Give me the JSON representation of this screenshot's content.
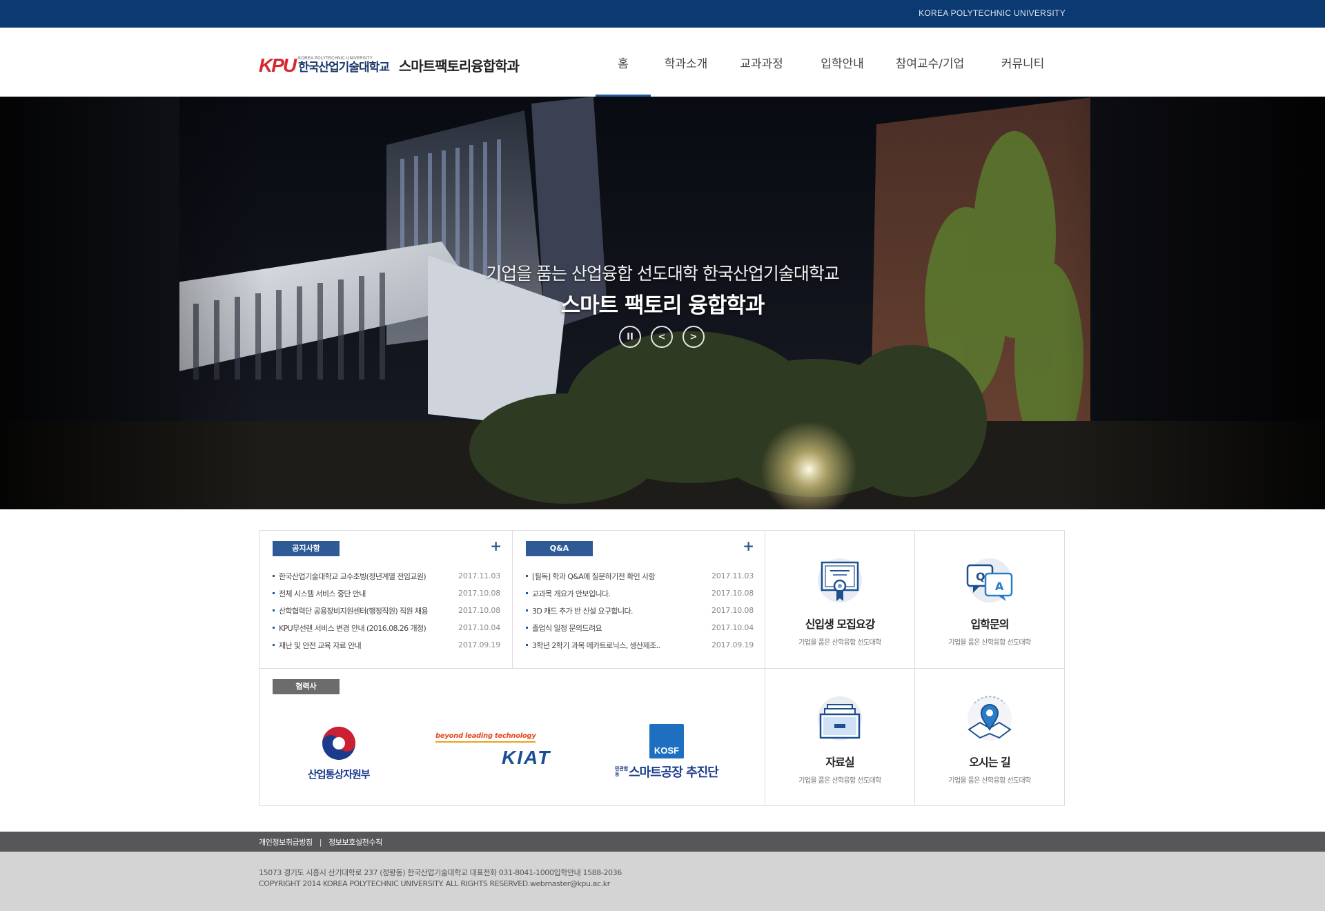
{
  "topbar": {
    "university": "KOREA POLYTECHNIC UNIVERSITY"
  },
  "header": {
    "logo_mark": "KPU",
    "logo_small": "KOREA POLYTECHNIC UNIVERSITY",
    "logo_name": "한국산업기술대학교",
    "dept": "스마트팩토리융합학과"
  },
  "nav": {
    "items": [
      {
        "label": "홈",
        "active": true
      },
      {
        "label": "학과소개"
      },
      {
        "label": "교과과정"
      },
      {
        "label": "입학안내"
      },
      {
        "label": "참여교수/기업"
      },
      {
        "label": "커뮤니티"
      }
    ]
  },
  "hero": {
    "caption1": "기업을 품는 산업융합 선도대학 한국산업기술대학교",
    "caption2": "스마트 팩토리 융합학과",
    "pause": "II",
    "prev": "<",
    "next": ">"
  },
  "notice": {
    "title": "공지사항",
    "more": "+",
    "items": [
      {
        "title": "한국산업기술대학교 교수초빙(정년계열 전임교원)",
        "date": "2017.11.03"
      },
      {
        "title": "전체 시스템 서비스 중단 안내",
        "date": "2017.10.08"
      },
      {
        "title": "산학협력단 공용장비지원센터(행정직원) 직원 채용",
        "date": "2017.10.08"
      },
      {
        "title": "KPU무선랜 서비스 변경 안내 (2016.08.26 개정)",
        "date": "2017.10.04"
      },
      {
        "title": "재난 및 안전 교육 자료 안내",
        "date": "2017.09.19"
      }
    ]
  },
  "qa": {
    "title": "Q&A",
    "more": "+",
    "items": [
      {
        "title": "[필독] 학과 Q&A에 질문하기전 확인 사항",
        "date": "2017.11.03"
      },
      {
        "title": "교과목 개요가 안보입니다.",
        "date": "2017.10.08"
      },
      {
        "title": "3D 캐드 추가 반 신설 요구합니다.",
        "date": "2017.10.08"
      },
      {
        "title": "졸업식 일정 문의드려요",
        "date": "2017.10.04"
      },
      {
        "title": "3학년 2학기 과목 메카트로닉스, 생산제조..",
        "date": "2017.09.19"
      }
    ]
  },
  "boxes": {
    "b1": {
      "title": "신입생 모집요강",
      "sub": "기업을 품은 산학융합 선도대학",
      "icon": "certificate-icon"
    },
    "b2": {
      "title": "입학문의",
      "sub": "기업을 품은 산학융합 선도대학",
      "icon": "qa-chat-icon"
    },
    "b3": {
      "title": "자료실",
      "sub": "기업을 품은 산학융합 선도대학",
      "icon": "archive-drawer-icon"
    },
    "b4": {
      "title": "오시는 길",
      "sub": "기업을 품은 산학융합 선도대학",
      "icon": "map-pin-icon"
    }
  },
  "partners": {
    "title": "협력사",
    "motie": "산업통상자원부",
    "kiat_tagline": "beyond leading technology",
    "kiat": "KIAT",
    "kosf_badge": "KOSF",
    "kosf_prefix": "민관합동",
    "kosf_name": "스마트공장 추진단"
  },
  "footer": {
    "privacy": "개인정보취급방침",
    "separator": "|",
    "security": "정보보호실천수칙",
    "address": "15073 경기도 시흥시 산기대학로 237 (정왕동) 한국산업기술대학교 대표전화 031-8041-1000입학안내 1588-2036",
    "copyright": "COPYRIGHT 2014 KOREA POLYTECHNIC UNIVERSITY. ALL RIGHTS RESERVED.webmaster@kpu.ac.kr"
  },
  "colors": {
    "navy": "#0b3a72",
    "accent": "#2e5a95",
    "footer_dark": "#57575a",
    "footer_light": "#d4d4d4"
  }
}
